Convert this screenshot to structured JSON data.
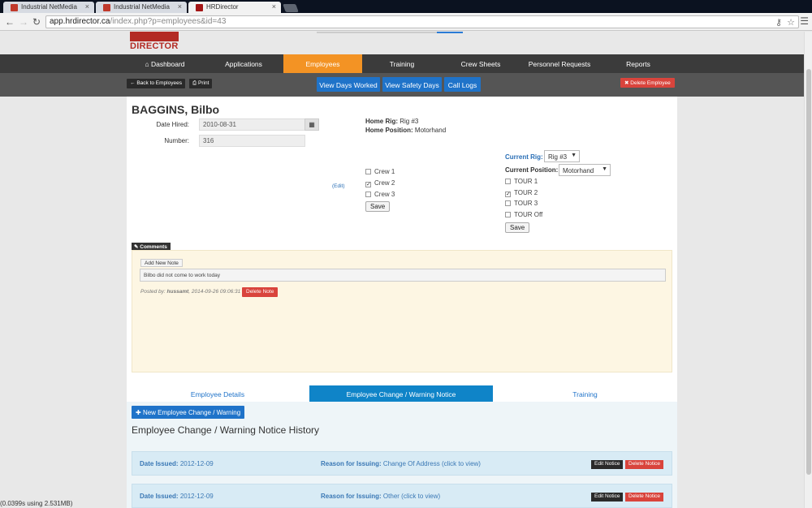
{
  "browser": {
    "tabs": [
      {
        "title": "Industrial NetMedia",
        "active": false
      },
      {
        "title": "Industrial NetMedia",
        "active": false
      },
      {
        "title": "HRDirector",
        "active": true
      }
    ],
    "url_host": "app.hrdirector.ca",
    "url_path": "/index.php?p=employees&id=43",
    "close_glyph": "×"
  },
  "site": {
    "logo_text": "DIRECTOR",
    "nav": [
      {
        "label": "Dashboard",
        "icon": "home-icon",
        "active": false
      },
      {
        "label": "Applications",
        "active": false
      },
      {
        "label": "Employees",
        "active": true
      },
      {
        "label": "Training",
        "active": false
      },
      {
        "label": "Crew Sheets",
        "active": false
      },
      {
        "label": "Personnel Requests",
        "active": false
      },
      {
        "label": "Reports",
        "active": false
      }
    ],
    "accent_color": "#f39324"
  },
  "subbar": {
    "back_label": "Back to Employees",
    "print_label": "Print",
    "view_days_worked": "View Days Worked",
    "view_safety_days": "View Safety Days",
    "call_logs": "Call Logs",
    "delete_employee": "Delete Employee"
  },
  "employee": {
    "name": "BAGGINS, Bilbo",
    "date_hired_label": "Date Hired:",
    "date_hired": "2010-08-31",
    "number_label": "Number:",
    "number": "316",
    "edit_link": "(Edit)",
    "home_rig_label": "Home Rig:",
    "home_rig": "Rig #3",
    "home_position_label": "Home Position:",
    "home_position": "Motorhand",
    "crews": [
      {
        "label": "Crew 1",
        "checked": false
      },
      {
        "label": "Crew 2",
        "checked": true
      },
      {
        "label": "Crew 3",
        "checked": false
      }
    ],
    "save_label": "Save",
    "current_rig_label": "Current Rig:",
    "current_rig": "Rig #3",
    "current_position_label": "Current Position:",
    "current_position": "Motorhand",
    "tours": [
      {
        "label": "TOUR 1",
        "checked": false
      },
      {
        "label": "TOUR 2",
        "checked": true
      },
      {
        "label": "TOUR 3",
        "checked": false
      },
      {
        "label": "TOUR Off",
        "checked": false
      }
    ],
    "save2_label": "Save"
  },
  "comments": {
    "tag": "Comments",
    "add_note": "Add New Note",
    "note_text": "Bilbo did not come to work today",
    "posted_prefix": "Posted by:",
    "posted_by": "hussamt",
    "posted_date": ", 2014-09-26 09:06:31",
    "delete_note": "Delete Note"
  },
  "content_tabs": [
    {
      "label": "Employee Details",
      "active": false
    },
    {
      "label": "Employee Change / Warning Notice",
      "active": true
    },
    {
      "label": "Training",
      "active": false
    }
  ],
  "history": {
    "new_button": "New Employee Change / Warning",
    "title": "Employee Change / Warning Notice History",
    "date_issued_label": "Date Issued:",
    "reason_label": "Reason for Issuing:",
    "edit_notice": "Edit Notice",
    "delete_notice": "Delete Notice",
    "rows": [
      {
        "date": "2012-12-09",
        "reason": "Change Of Address (click to view)"
      },
      {
        "date": "2012-12-09",
        "reason": "Other (click to view)"
      }
    ]
  },
  "footer": {
    "text": "(0.0399s using 2.531MB)"
  }
}
